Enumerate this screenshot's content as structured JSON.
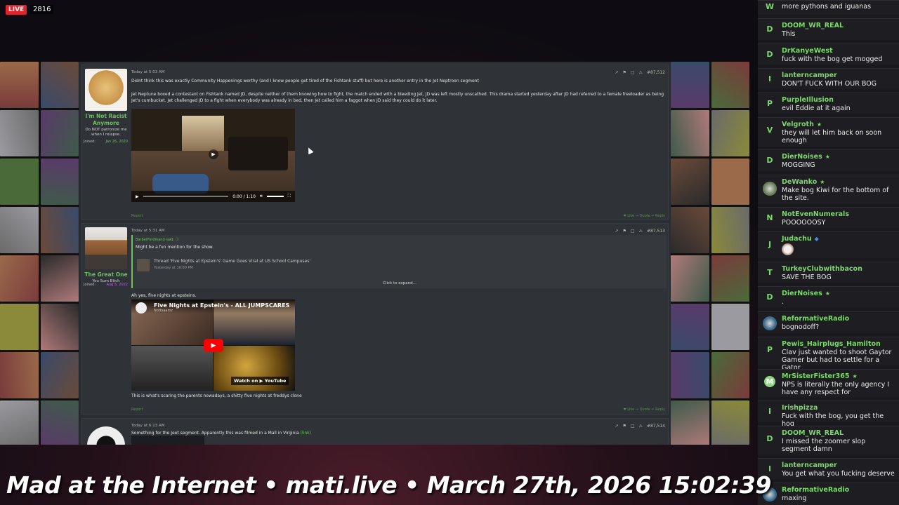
{
  "stream": {
    "live_label": "LIVE",
    "viewers": "2816"
  },
  "caption": "Mad at the Internet • mati.live • March 27th, 2026 15:02:39",
  "forum": {
    "posts": [
      {
        "time": "Today at 5:03 AM",
        "number": "#87,512",
        "author": {
          "name": "I'm Not Racist Anymore",
          "title": "Do NOT patronize me when I relapse.",
          "joined_label": "Joined:",
          "joined": "Jan 26, 2020"
        },
        "paragraphs": [
          "Didnt think this was exactly Community Happenings worthy (and I know people get tired of the Fishtank stuff) but here is another entry in the Jet Neptroon segment",
          "Jet Neptune boxed a contestant on Fishtank named JD, despite neither of them knowing how to fight, the match ended with a bleeding Jet, JD was left mostly unscathed. This drama started yesterday after JD had referred to a female freeloader as being Jet's cumbucket. Jet challenged JD to a fight when everybody was already in bed, then Jet called him a faggot when JD said they could do it later."
        ],
        "video_time": "0:00 / 1:10",
        "report": "Report",
        "actions": "❤ Like  → Quote  ↩ Reply"
      },
      {
        "time": "Today at 5:31 AM",
        "number": "#87,513",
        "author": {
          "name": "The Great One",
          "title": "You Sum Bitch",
          "joined_label": "Joined:",
          "joined": "Aug 5, 2022"
        },
        "quote_author": "BarberFerdinand said: ⓘ",
        "quote_text": "Might be a fun mention for the show.",
        "thread_link": "Thread 'Five Nights at Epstein's' Game Goes Viral at US School Campuses'",
        "thread_date": "Yesterday at 10:00 PM",
        "expand": "Click to expand...",
        "reply": "Ah yes, five nights at epsteins.",
        "yt_title": "Five Nights at Epstein's - ALL JUMPSCARES",
        "yt_channel": "Nottsaamz",
        "yt_watch": "Watch on ▶ YouTube",
        "after": "This is what's scaring the parents nowadays, a shitty five nights at freddys clone",
        "report": "Report",
        "actions": "❤ Like  → Quote  ↩ Reply"
      },
      {
        "time": "Today at 6:13 AM",
        "number": "#87,514",
        "text": "Something for the Jeet segment. Apparently this was filmed in a Mall in Virginia",
        "link": "(link)"
      }
    ]
  },
  "chat": {
    "messages": [
      {
        "badge": "W",
        "name": "",
        "text": "more pythons and iguanas"
      },
      {
        "badge": "D",
        "name": "DOOM_WR_REAL",
        "text": "This"
      },
      {
        "badge": "D",
        "name": "DrKanyeWest",
        "text": "fuck with the bog get mogged"
      },
      {
        "badge": "l",
        "name": "lanterncamper",
        "text": "DON'T FUCK WITH OUR BOG"
      },
      {
        "badge": "P",
        "name": "PurpleIllusion",
        "text": "evil Eddie at it again"
      },
      {
        "badge": "V",
        "name": "Velgroth",
        "star": "★",
        "text": "they will let him back on soon enough"
      },
      {
        "badge": "D",
        "name": "DierNoises",
        "star": "★",
        "text": "MOGGING"
      },
      {
        "badge": "",
        "name": "DeWanko",
        "star": "★",
        "text": "Make bog Kiwi for the bottom of the site."
      },
      {
        "badge": "N",
        "name": "NotEvenNumerals",
        "text": "POOOOOOSY"
      },
      {
        "badge": "J",
        "name": "Judachu",
        "star": "◆",
        "text": ""
      },
      {
        "badge": "T",
        "name": "TurkeyClubwithbacon",
        "text": "SAVE THE BOG"
      },
      {
        "badge": "D",
        "name": "DierNoises",
        "star": "★",
        "text": "."
      },
      {
        "badge": "",
        "name": "ReformativeRadio",
        "text": "bognodoff?"
      },
      {
        "badge": "P",
        "name": "Pewis_Hairplugs_Hamilton",
        "text": "Clav just wanted to shoot Gaytor Gamer but had to settle for a Gator"
      },
      {
        "badge": "M",
        "name": "MrSisterFister365",
        "star": "★",
        "text": "NPS is literally the only agency I have any respect for"
      },
      {
        "badge": "I",
        "name": "Irishpizza",
        "text": "Fuck with the bog, you get the hog"
      },
      {
        "badge": "D",
        "name": "DOOM_WR_REAL",
        "text": "I missed the zoomer slop segment damn"
      },
      {
        "badge": "l",
        "name": "lanterncamper",
        "text": "You get what you fucking deserve"
      },
      {
        "badge": "",
        "name": "ReformativeRadio",
        "text": "maxing"
      }
    ]
  }
}
